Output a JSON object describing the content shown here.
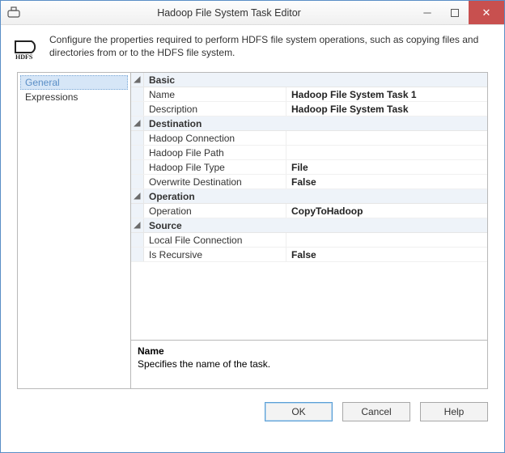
{
  "window": {
    "title": "Hadoop File System Task Editor"
  },
  "header": {
    "icon_label": "HDFS",
    "description": "Configure the properties required to perform HDFS file system operations, such as copying files and directories from or to the HDFS file system."
  },
  "nav": {
    "items": [
      {
        "label": "General",
        "selected": true
      },
      {
        "label": "Expressions",
        "selected": false
      }
    ]
  },
  "property_grid": {
    "categories": [
      {
        "name": "Basic",
        "props": [
          {
            "name": "Name",
            "value": "Hadoop File System Task 1"
          },
          {
            "name": "Description",
            "value": "Hadoop File System Task"
          }
        ]
      },
      {
        "name": "Destination",
        "props": [
          {
            "name": "Hadoop Connection",
            "value": ""
          },
          {
            "name": "Hadoop File Path",
            "value": ""
          },
          {
            "name": "Hadoop File Type",
            "value": "File"
          },
          {
            "name": "Overwrite Destination",
            "value": "False"
          }
        ]
      },
      {
        "name": "Operation",
        "props": [
          {
            "name": "Operation",
            "value": "CopyToHadoop"
          }
        ]
      },
      {
        "name": "Source",
        "props": [
          {
            "name": "Local File Connection",
            "value": ""
          },
          {
            "name": "Is Recursive",
            "value": "False"
          }
        ]
      }
    ],
    "description": {
      "title": "Name",
      "text": "Specifies the name of the task."
    }
  },
  "buttons": {
    "ok": "OK",
    "cancel": "Cancel",
    "help": "Help"
  }
}
